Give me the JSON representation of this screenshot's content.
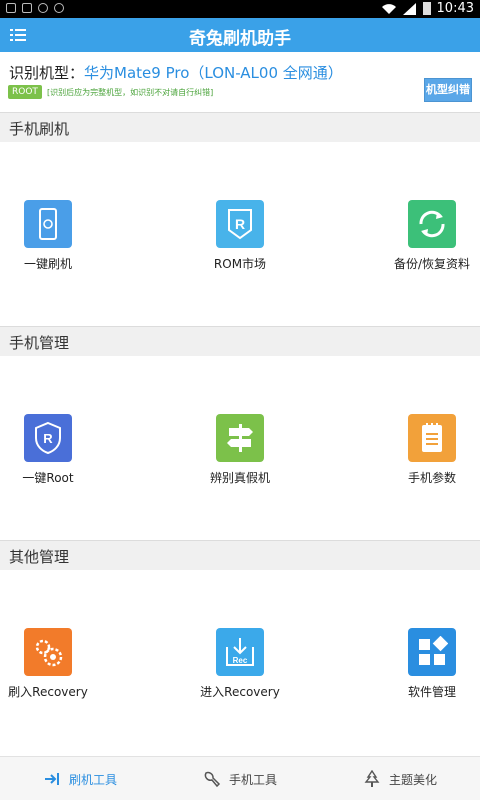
{
  "status_bar": {
    "time": "10:43"
  },
  "header": {
    "title": "奇兔刷机助手"
  },
  "device": {
    "label": "识别机型：",
    "model": "华为Mate9 Pro（LON-AL00 全网通）",
    "root_badge": "ROOT",
    "hint": "[识别后应为完整机型，如识别不对请自行纠错]",
    "fix_button": "机型纠错"
  },
  "sections": [
    {
      "title": "手机刷机",
      "items": [
        {
          "label": "一键刷机",
          "icon": "phone-flash-icon",
          "color": "#4a9ee8"
        },
        {
          "label": "ROM市场",
          "icon": "rom-market-icon",
          "color": "#48b3ea"
        },
        {
          "label": "备份/恢复资料",
          "icon": "backup-restore-icon",
          "color": "#3cc079"
        }
      ]
    },
    {
      "title": "手机管理",
      "items": [
        {
          "label": "一键Root",
          "icon": "root-shield-icon",
          "color": "#4a6fd8"
        },
        {
          "label": "辨别真假机",
          "icon": "signpost-icon",
          "color": "#7cc14a"
        },
        {
          "label": "手机参数",
          "icon": "notepad-icon",
          "color": "#f2a13a"
        }
      ]
    },
    {
      "title": "其他管理",
      "items": [
        {
          "label": "刷入Recovery",
          "icon": "gears-icon",
          "color": "#f27b2a"
        },
        {
          "label": "进入Recovery",
          "icon": "rec-download-icon",
          "color": "#3ba9ea"
        },
        {
          "label": "软件管理",
          "icon": "apps-grid-icon",
          "color": "#2a8ee0"
        }
      ]
    }
  ],
  "bottom_nav": [
    {
      "label": "刷机工具",
      "active": true
    },
    {
      "label": "手机工具",
      "active": false
    },
    {
      "label": "主题美化",
      "active": false
    }
  ],
  "colors": {
    "accent": "#3aa1e8",
    "active_tab": "#2a8ee0"
  }
}
